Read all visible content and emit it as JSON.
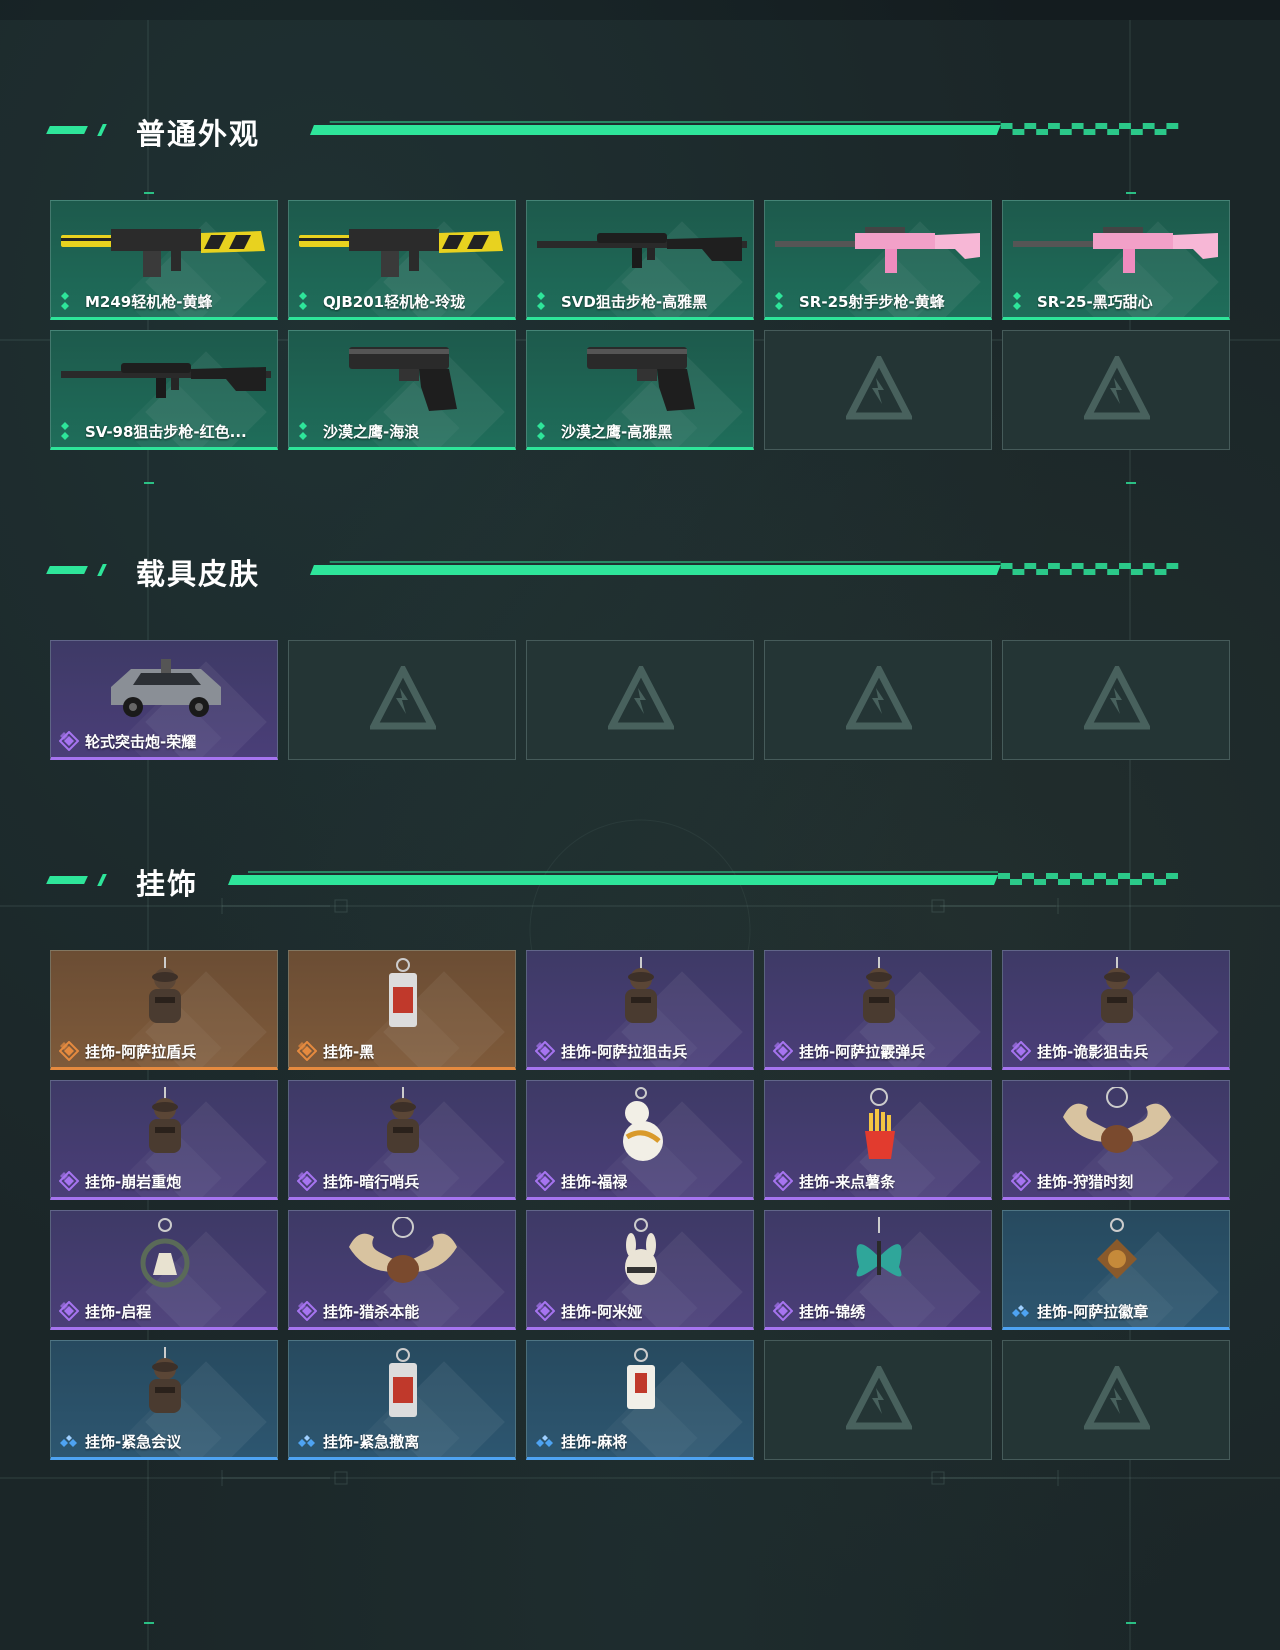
{
  "colors": {
    "accent": "#2ee59a",
    "rarity_green": "#2ee59a",
    "rarity_purple": "#a674f0",
    "rarity_orange": "#e58a3f",
    "rarity_blue": "#4ea3f2"
  },
  "sections": [
    {
      "title": "普通外观",
      "items": [
        {
          "label": "M249轻机枪-黄蜂",
          "rarity": "green",
          "icon": "machine-gun-icon"
        },
        {
          "label": "QJB201轻机枪-玲珑",
          "rarity": "green",
          "icon": "machine-gun-icon"
        },
        {
          "label": "SVD狙击步枪-高雅黑",
          "rarity": "green",
          "icon": "sniper-rifle-icon"
        },
        {
          "label": "SR-25射手步枪-黄蜂",
          "rarity": "green",
          "icon": "rifle-icon"
        },
        {
          "label": "SR-25-黑巧甜心",
          "rarity": "green",
          "icon": "rifle-icon"
        },
        {
          "label": "SV-98狙击步枪-红色...",
          "rarity": "green",
          "icon": "sniper-rifle-icon"
        },
        {
          "label": "沙漠之鹰-海浪",
          "rarity": "green",
          "icon": "pistol-icon"
        },
        {
          "label": "沙漠之鹰-高雅黑",
          "rarity": "green",
          "icon": "pistol-icon"
        },
        {
          "label": "",
          "rarity": "empty",
          "icon": "empty-slot-logo-icon"
        },
        {
          "label": "",
          "rarity": "empty",
          "icon": "empty-slot-logo-icon"
        }
      ]
    },
    {
      "title": "载具皮肤",
      "items": [
        {
          "label": "轮式突击炮-荣耀",
          "rarity": "purple",
          "icon": "vehicle-icon"
        },
        {
          "label": "",
          "rarity": "empty",
          "icon": "empty-slot-logo-icon"
        },
        {
          "label": "",
          "rarity": "empty",
          "icon": "empty-slot-logo-icon"
        },
        {
          "label": "",
          "rarity": "empty",
          "icon": "empty-slot-logo-icon"
        },
        {
          "label": "",
          "rarity": "empty",
          "icon": "empty-slot-logo-icon"
        }
      ]
    },
    {
      "title": "挂饰",
      "items": [
        {
          "label": "挂饰-阿萨拉盾兵",
          "rarity": "orange",
          "icon": "charm-figure-icon"
        },
        {
          "label": "挂饰-黑",
          "rarity": "orange",
          "icon": "charm-tag-icon"
        },
        {
          "label": "挂饰-阿萨拉狙击兵",
          "rarity": "purple",
          "icon": "charm-figure-icon"
        },
        {
          "label": "挂饰-阿萨拉霰弹兵",
          "rarity": "purple",
          "icon": "charm-figure-icon"
        },
        {
          "label": "挂饰-诡影狙击兵",
          "rarity": "purple",
          "icon": "charm-figure-icon"
        },
        {
          "label": "挂饰-崩岩重炮",
          "rarity": "purple",
          "icon": "charm-figure-icon"
        },
        {
          "label": "挂饰-暗行哨兵",
          "rarity": "purple",
          "icon": "charm-figure-icon"
        },
        {
          "label": "挂饰-福禄",
          "rarity": "purple",
          "icon": "charm-gourd-icon"
        },
        {
          "label": "挂饰-来点薯条",
          "rarity": "purple",
          "icon": "charm-fries-icon"
        },
        {
          "label": "挂饰-狩猎时刻",
          "rarity": "purple",
          "icon": "charm-antler-icon"
        },
        {
          "label": "挂饰-启程",
          "rarity": "purple",
          "icon": "charm-ring-icon"
        },
        {
          "label": "挂饰-猎杀本能",
          "rarity": "purple",
          "icon": "charm-antler-icon"
        },
        {
          "label": "挂饰-阿米娅",
          "rarity": "purple",
          "icon": "charm-rabbit-icon"
        },
        {
          "label": "挂饰-锦绣",
          "rarity": "purple",
          "icon": "charm-butterfly-icon"
        },
        {
          "label": "挂饰-阿萨拉徽章",
          "rarity": "blue",
          "icon": "charm-badge-icon"
        },
        {
          "label": "挂饰-紧急会议",
          "rarity": "blue",
          "icon": "charm-figure-icon"
        },
        {
          "label": "挂饰-紧急撤离",
          "rarity": "blue",
          "icon": "charm-tag-icon"
        },
        {
          "label": "挂饰-麻将",
          "rarity": "blue",
          "icon": "charm-mahjong-icon"
        },
        {
          "label": "",
          "rarity": "empty",
          "icon": "empty-slot-logo-icon"
        },
        {
          "label": "",
          "rarity": "empty",
          "icon": "empty-slot-logo-icon"
        }
      ]
    }
  ]
}
